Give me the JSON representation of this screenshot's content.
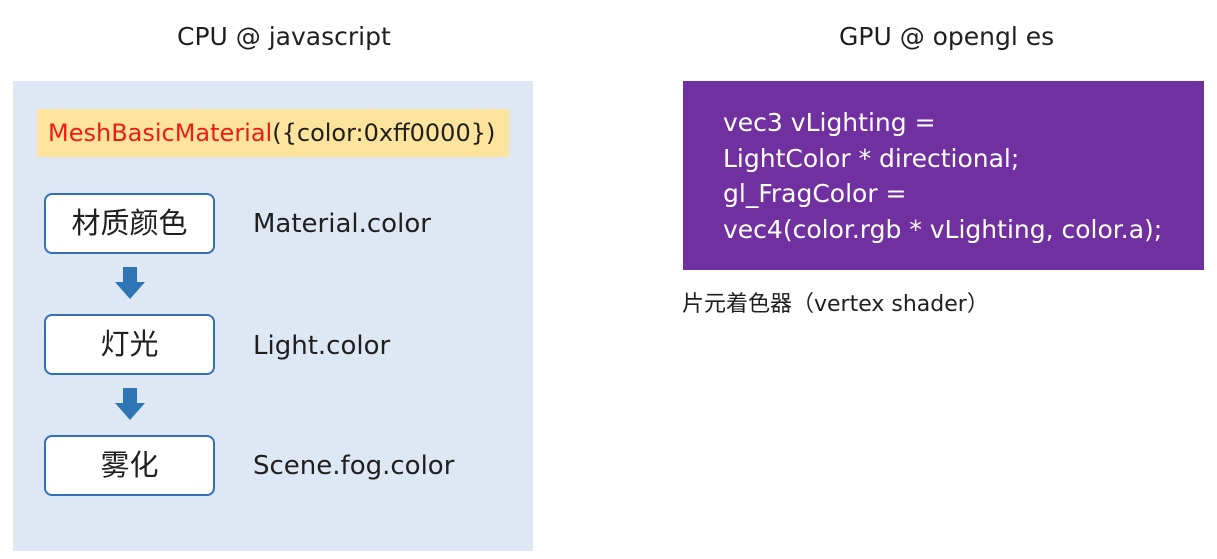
{
  "cpu": {
    "title": "CPU @ javascript",
    "constructor": {
      "class_name": "MeshBasicMaterial",
      "args": "({color:0xff0000})"
    },
    "stages": [
      {
        "label": "材质颜色",
        "property": "Material.color"
      },
      {
        "label": "灯光",
        "property": "Light.color"
      },
      {
        "label": "雾化",
        "property": "Scene.fog.color"
      }
    ]
  },
  "gpu": {
    "title": "GPU @ opengl es",
    "code_lines": [
      "vec3 vLighting =",
      "LightColor * directional;",
      "gl_FragColor =",
      "vec4(color.rgb * vLighting, color.a);"
    ],
    "caption": "片元着色器（vertex shader）"
  },
  "colors": {
    "cpu_panel_bg": "#dde8f4",
    "constructor_bg": "#fde49c",
    "class_name_red": "#ee1b16",
    "stage_border": "#3370b6",
    "arrow_blue": "#2e75b6",
    "shader_bg": "#7030a0"
  }
}
